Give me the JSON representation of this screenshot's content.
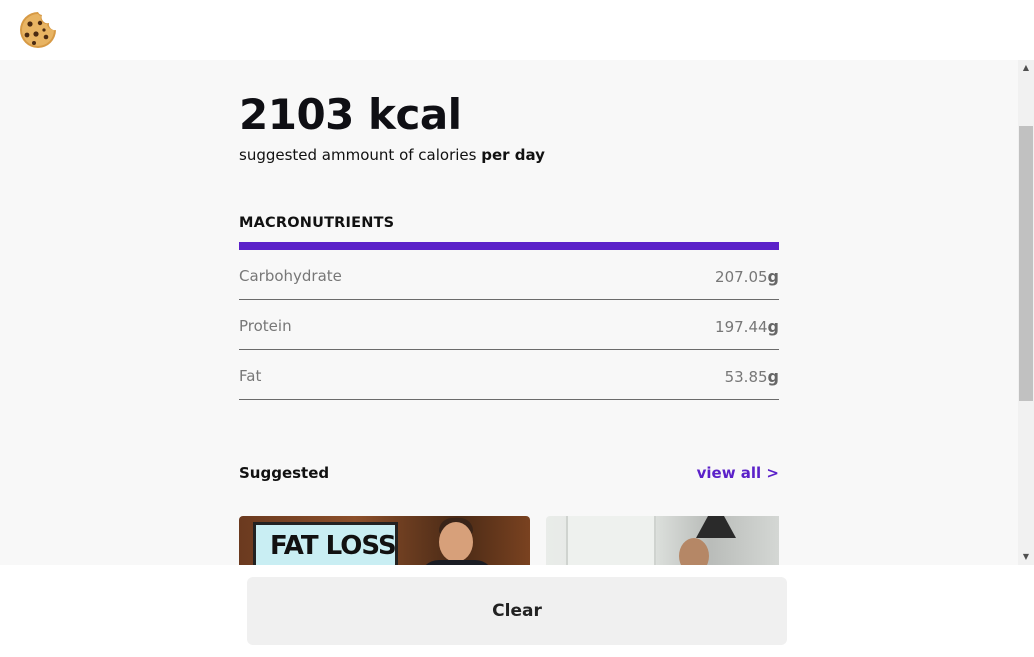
{
  "header": {
    "logo_icon": "cookie-icon"
  },
  "summary": {
    "kcal": "2103 kcal",
    "subtitle_prefix": "suggested ammount of calories ",
    "subtitle_bold": "per day"
  },
  "macronutrients": {
    "title": "MACRONUTRIENTS",
    "accent_color": "#5b21c9",
    "items": [
      {
        "name": "Carbohydrate",
        "value": "207.05",
        "unit": "g"
      },
      {
        "name": "Protein",
        "value": "197.44",
        "unit": "g"
      },
      {
        "name": "Fat",
        "value": "53.85",
        "unit": "g"
      }
    ]
  },
  "suggested": {
    "title": "Suggested",
    "view_all": "view all >",
    "videos": [
      {
        "thumbnail_text": "FAT LOSS"
      },
      {
        "thumbnail_text": ""
      }
    ]
  },
  "actions": {
    "clear_label": "Clear"
  }
}
